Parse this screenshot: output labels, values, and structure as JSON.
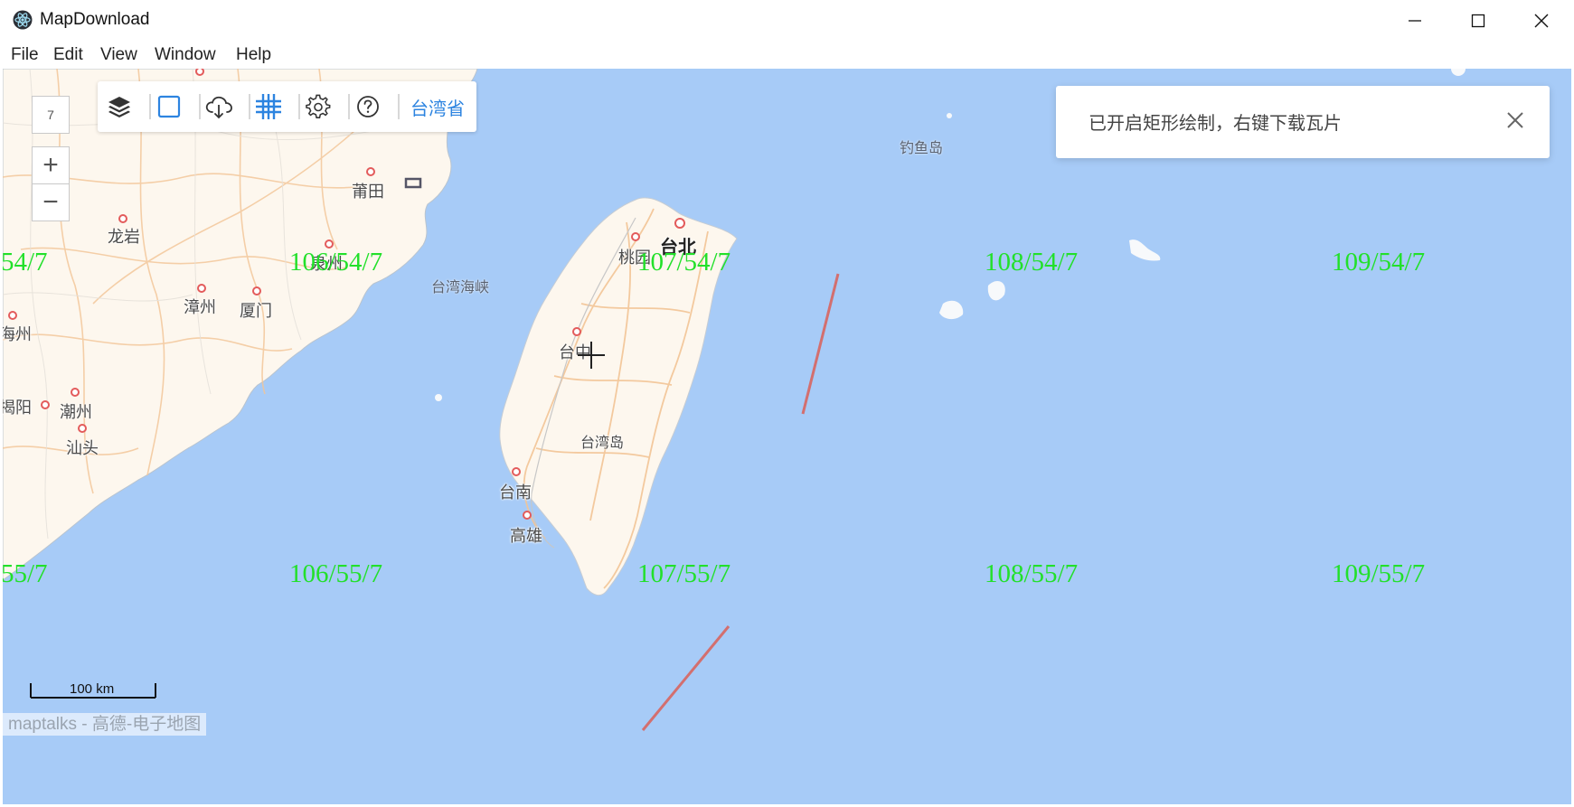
{
  "window": {
    "title": "MapDownload",
    "controls": [
      "minimize",
      "maximize",
      "close"
    ]
  },
  "menu": [
    "File",
    "Edit",
    "View",
    "Window",
    "Help"
  ],
  "zoom": {
    "level": "7",
    "plus": "+",
    "minus": "−"
  },
  "toolbar": {
    "buttons": [
      {
        "name": "layers",
        "icon": "layers-icon"
      },
      {
        "name": "draw-rectangle",
        "icon": "rectangle-icon"
      },
      {
        "name": "download",
        "icon": "cloud-download-icon"
      },
      {
        "name": "tile-grid",
        "icon": "grid-icon"
      },
      {
        "name": "settings",
        "icon": "gear-icon"
      },
      {
        "name": "help",
        "icon": "question-icon"
      }
    ],
    "region_label": "台湾省",
    "accent_color": "#2d84e0"
  },
  "notification": {
    "message": "已开启矩形绘制，右键下载瓦片"
  },
  "map_labels": {
    "putian": "莆田",
    "longyan": "龙岩",
    "quanzhou": "泉州",
    "zhangzhou": "漳州",
    "xiamen": "厦门",
    "haizhou": "海州",
    "jieyang": "揭阳",
    "chaozhou": "潮州",
    "shantou": "汕头",
    "strait": "台湾海峡",
    "diaoyu": "钓鱼岛",
    "taipei": "台北",
    "taoyuan": "桃园",
    "taichung": "台中",
    "taiwan_island": "台湾岛",
    "tainan": "台南",
    "kaohsiung": "高雄"
  },
  "tile_labels": {
    "r54": [
      "54/7",
      "106/54/7",
      "107/54/7",
      "108/54/7",
      "109/54/7"
    ],
    "r55": [
      "55/7",
      "106/55/7",
      "107/55/7",
      "108/55/7",
      "109/55/7"
    ]
  },
  "scale": {
    "text": "100 km"
  },
  "attribution": {
    "text": "maptalks - 高德-电子地图"
  },
  "colors": {
    "sea": "#a7cbf7",
    "land": "#fdf7ee",
    "tile_label": "#22e02a"
  }
}
